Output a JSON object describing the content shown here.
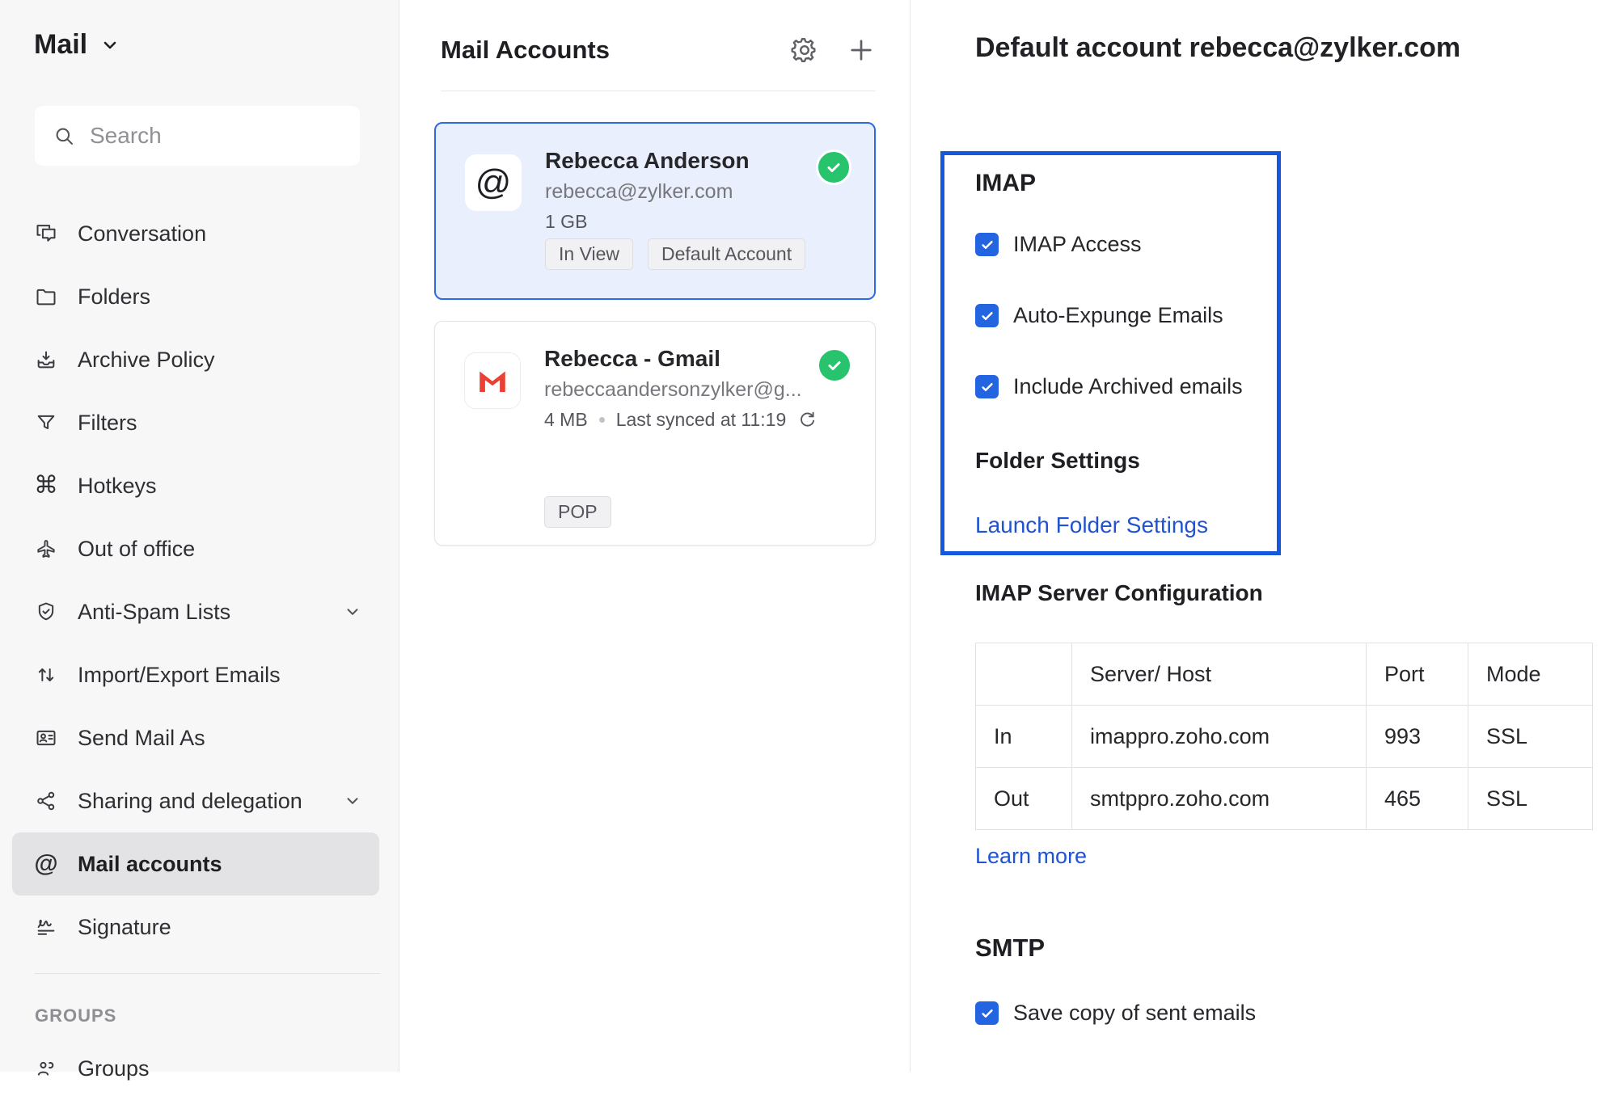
{
  "sidebar": {
    "app_title": "Mail",
    "search": {
      "placeholder": "Search"
    },
    "items": [
      {
        "label": "Conversation",
        "icon": "conversation-icon"
      },
      {
        "label": "Folders",
        "icon": "folder-icon"
      },
      {
        "label": "Archive Policy",
        "icon": "archive-icon"
      },
      {
        "label": "Filters",
        "icon": "filter-icon"
      },
      {
        "label": "Hotkeys",
        "icon": "command-icon"
      },
      {
        "label": "Out of office",
        "icon": "airplane-icon"
      },
      {
        "label": "Anti-Spam Lists",
        "icon": "shield-check-icon",
        "expandable": true
      },
      {
        "label": "Import/Export Emails",
        "icon": "arrows-up-down-icon"
      },
      {
        "label": "Send Mail As",
        "icon": "send-mail-as-icon"
      },
      {
        "label": "Sharing and delegation",
        "icon": "share-icon",
        "expandable": true
      },
      {
        "label": "Mail accounts",
        "icon": "at-icon",
        "selected": true
      },
      {
        "label": "Signature",
        "icon": "signature-icon"
      }
    ],
    "groups_section": {
      "label": "GROUPS",
      "item": "Groups",
      "icon": "people-icon"
    }
  },
  "accounts_panel": {
    "title": "Mail Accounts",
    "actions": {
      "settings": "settings-gear",
      "add": "add-account"
    },
    "cards": [
      {
        "name": "Rebecca Anderson",
        "email": "rebecca@zylker.com",
        "storage": "1 GB",
        "tags": [
          "In View",
          "Default Account"
        ],
        "icon": "at-avatar",
        "status": "active",
        "selected": true
      },
      {
        "name": "Rebecca - Gmail",
        "email": "rebeccaandersonzylker@g...",
        "storage": "4 MB",
        "synced": "Last synced at 11:19",
        "tags": [
          "POP"
        ],
        "icon": "gmail-avatar",
        "status": "active",
        "selected": false
      }
    ]
  },
  "detail_panel": {
    "title": "Default account rebecca@zylker.com",
    "imap": {
      "heading": "IMAP",
      "checkboxes": [
        "IMAP Access",
        "Auto-Expunge Emails",
        "Include Archived emails"
      ],
      "checked": [
        true,
        true,
        true
      ],
      "folder_settings_heading": "Folder Settings",
      "folder_settings_link": "Launch Folder Settings"
    },
    "server_config": {
      "heading": "IMAP Server Configuration",
      "columns": [
        "",
        "Server/ Host",
        "Port",
        "Mode"
      ],
      "rows": [
        [
          "In",
          "imappro.zoho.com",
          "993",
          "SSL"
        ],
        [
          "Out",
          "smtppro.zoho.com",
          "465",
          "SSL"
        ]
      ],
      "learn_more": "Learn more"
    },
    "smtp": {
      "heading": "SMTP",
      "checkboxes": [
        "Save copy of sent emails"
      ],
      "checked": [
        true
      ]
    }
  },
  "colors": {
    "accent_blue": "#2365e1",
    "imap_highlight_border": "#1558dc",
    "selected_card_border": "#2e6be1",
    "selected_card_bg": "#e9effc",
    "success_green": "#27c46d",
    "link_blue": "#2053cf",
    "gmail_red": "#e94134",
    "sidebar_bg": "#f7f7f8"
  }
}
